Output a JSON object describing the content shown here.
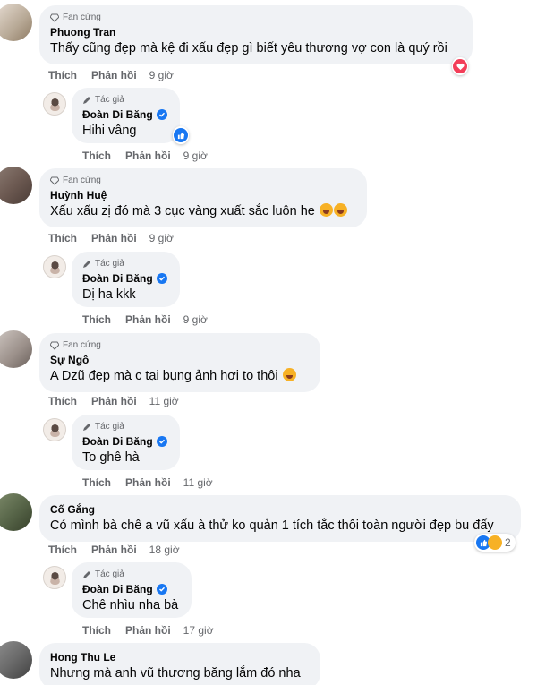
{
  "actions": {
    "like": "Thích",
    "reply": "Phản hồi"
  },
  "badges": {
    "fan": "Fan cứng",
    "author": "Tác giả"
  },
  "comments": [
    {
      "name": "Phuong Tran",
      "text": "Thấy cũng đẹp mà kệ đi xấu đẹp gì biết yêu thương vợ con là quý rồi",
      "time": "9 giờ",
      "reaction": "heart-reaction"
    },
    {
      "name": "Huỳnh Huệ",
      "text": "Xấu xấu zị đó mà 3 cục vàng xuất sắc luôn he",
      "time": "9 giờ"
    },
    {
      "name": "Sự Ngô",
      "text": "A Dzũ đẹp mà c tại bụng ảnh hơi to thôi",
      "time": "11 giờ"
    },
    {
      "name": "Cố Gắng",
      "text": "Có mình bà chê a vũ xấu à thử ko quản 1 tích tắc thôi toàn người đẹp bu đấy",
      "time": "18 giờ",
      "reaction_count": "2"
    },
    {
      "name": "Hong Thu Le",
      "text": "Nhưng mà anh vũ thương băng lắm đó nha"
    }
  ],
  "replies": [
    {
      "name": "Đoàn Di Băng",
      "text": "Hihi vâng",
      "time": "9 giờ"
    },
    {
      "name": "Đoàn Di Băng",
      "text": "Dị ha kkk",
      "time": "9 giờ"
    },
    {
      "name": "Đoàn Di Băng",
      "text": "To ghê hà",
      "time": "11 giờ"
    },
    {
      "name": "Đoàn Di Băng",
      "text": "Chê nhìu nha bà",
      "time": "17 giờ"
    }
  ],
  "colors": {
    "bubble": "#f0f2f5",
    "muted": "#65676b",
    "verified": "#1877f2",
    "heart": "#f33e58"
  }
}
